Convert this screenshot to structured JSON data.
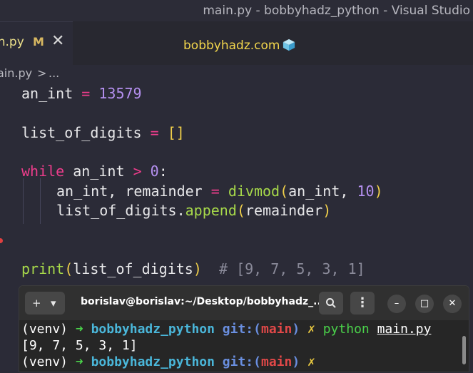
{
  "window": {
    "title": "main.py - bobbyhadz_python - Visual Studio"
  },
  "tab": {
    "label": "in.py",
    "modified": "M",
    "close": "✕"
  },
  "watermark": {
    "text": "bobbyhadz.com"
  },
  "breadcrumb": {
    "file": "ain.py",
    "sep": ">",
    "more": "..."
  },
  "code": {
    "l1": {
      "name": "an_int",
      "op": "=",
      "value": "13579"
    },
    "l3": {
      "name": "list_of_digits",
      "op": "=",
      "value": "[]"
    },
    "l5": {
      "kw": "while",
      "name": "an_int",
      "op": ">",
      "value": "0",
      "colon": ":"
    },
    "l6": {
      "targets": "an_int, remainder",
      "op": "=",
      "fn": "divmod",
      "open": "(",
      "arg1": "an_int, ",
      "arg2": "10",
      "close": ")"
    },
    "l7": {
      "obj": "list_of_digits.",
      "fn": "append",
      "open": "(",
      "arg": "remainder",
      "close": ")"
    },
    "l10": {
      "fn": "print",
      "open": "(",
      "arg": "list_of_digits",
      "close": ")",
      "comment": "# [9, 7, 5, 3, 1]"
    }
  },
  "terminal": {
    "title": "borislav@borislav:~/Desktop/bobbyhadz_...",
    "new_tab_icon": "+",
    "dropdown_icon": "▾",
    "search_icon": "🔍",
    "menu_icon": "⋮",
    "minimize_icon": "–",
    "maximize_icon": "□",
    "close_icon": "✕",
    "lines": [
      {
        "venv": "(venv)",
        "arrow": "➜",
        "dir": "bobbyhadz_python",
        "git": "git:(",
        "branch": "main",
        "git_close": ")",
        "x": "✗",
        "cmd": "python",
        "arg": "main.py"
      },
      {
        "output": "[9, 7, 5, 3, 1]"
      },
      {
        "venv": "(venv)",
        "arrow": "➜",
        "dir": "bobbyhadz_python",
        "git": "git:(",
        "branch": "main",
        "git_close": ")",
        "x": "✗"
      }
    ]
  }
}
